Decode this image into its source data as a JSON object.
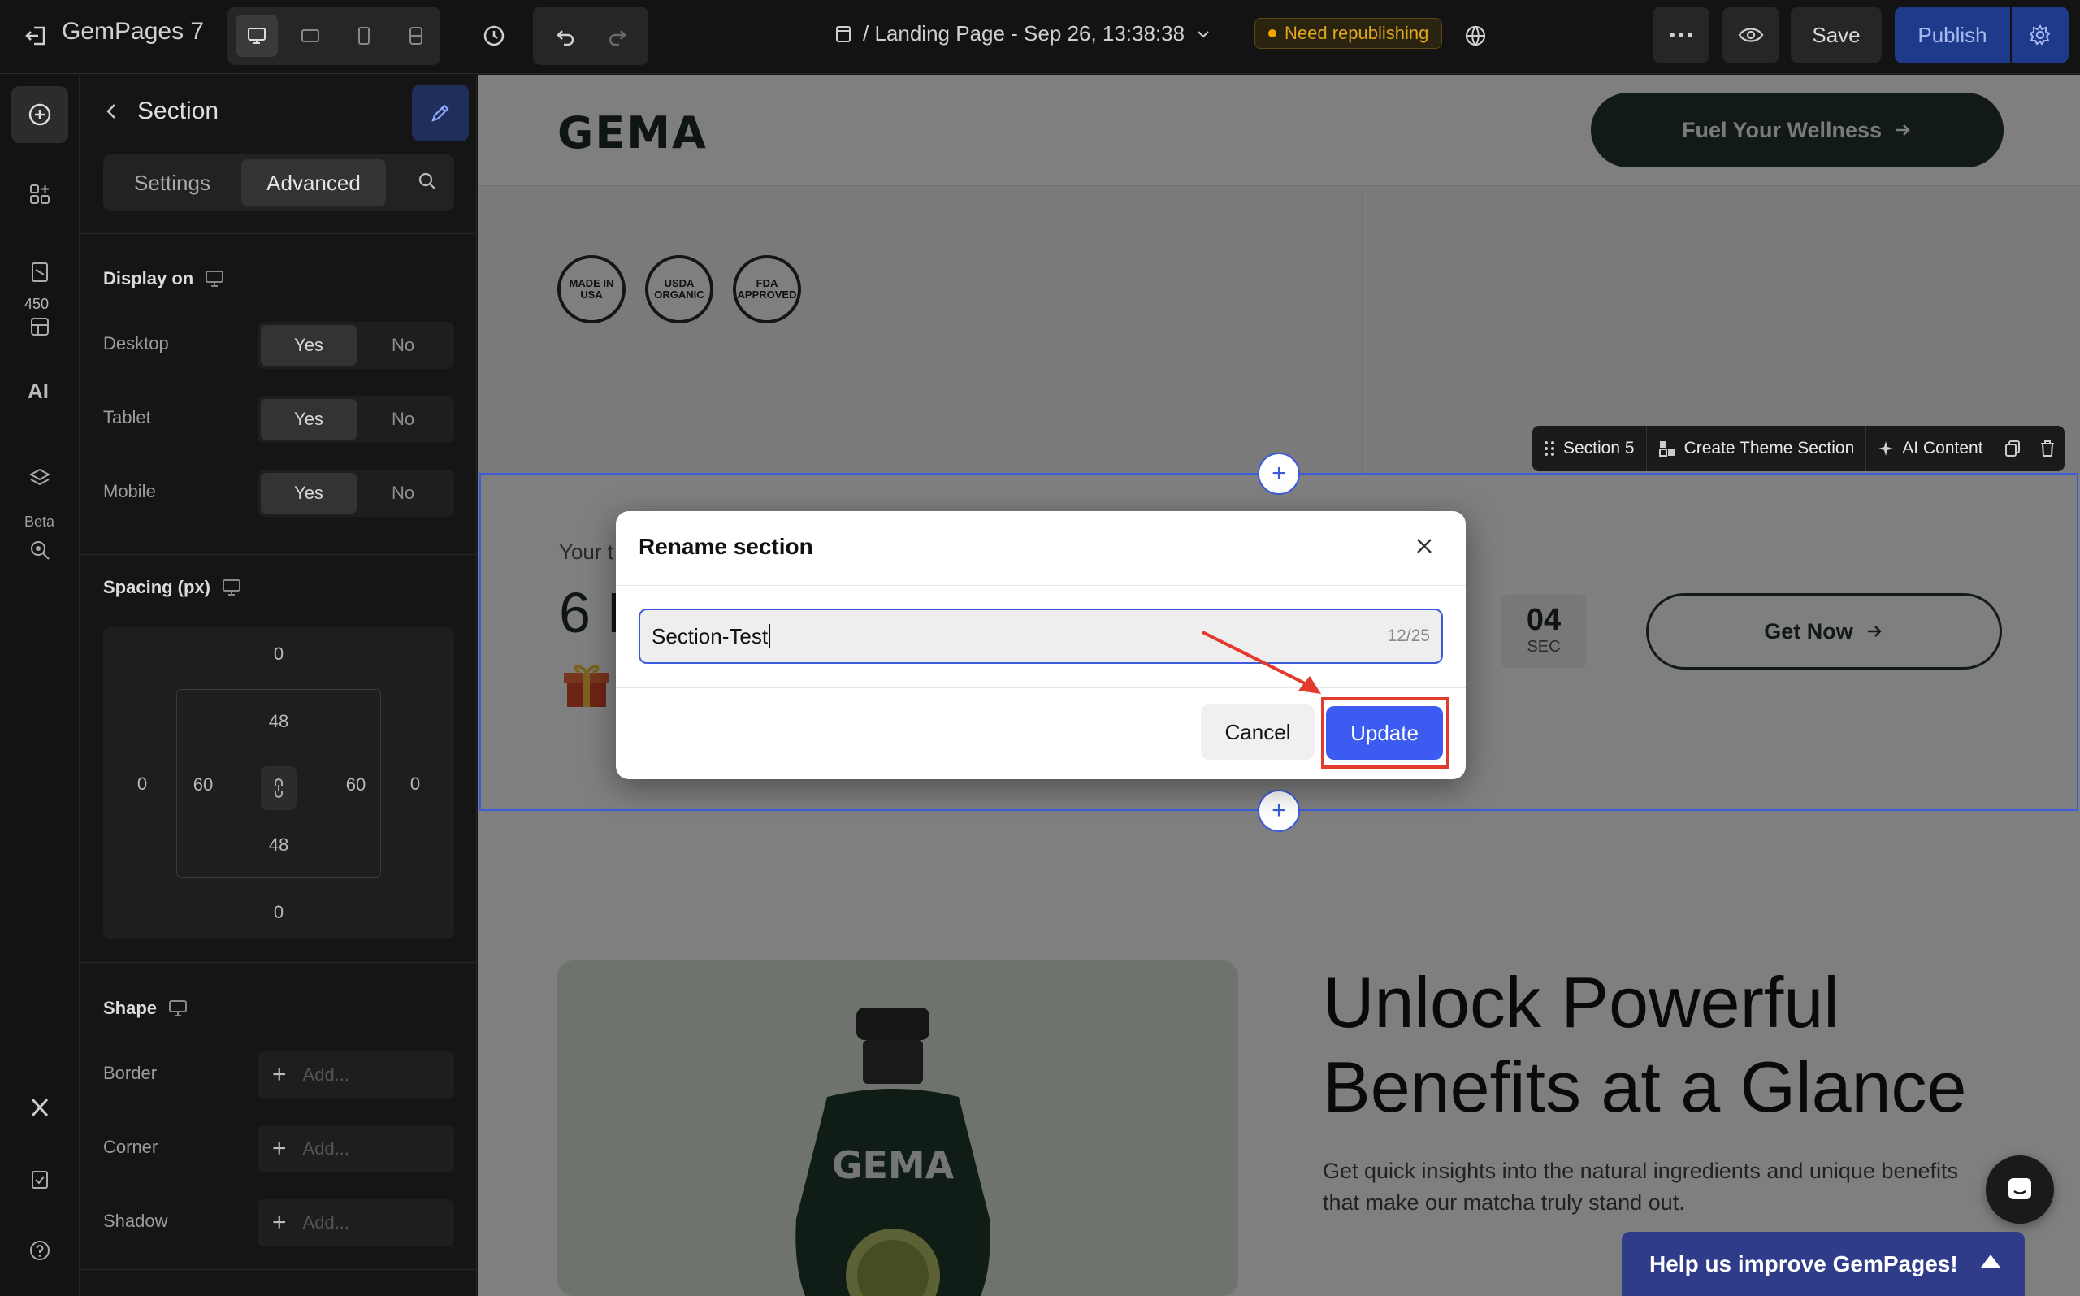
{
  "app": {
    "name": "GemPages 7",
    "page_title": "/ Landing Page - Sep 26, 13:38:38",
    "status_badge": "Need republishing",
    "save_label": "Save",
    "publish_label": "Publish"
  },
  "rail": {
    "count_badge": "450",
    "ai_label": "AI",
    "beta_label": "Beta"
  },
  "panel": {
    "title": "Section",
    "tabs": [
      "Settings",
      "Advanced"
    ],
    "display_on": {
      "label": "Display on",
      "rows": [
        {
          "label": "Desktop",
          "yes": "Yes",
          "no": "No"
        },
        {
          "label": "Tablet",
          "yes": "Yes",
          "no": "No"
        },
        {
          "label": "Mobile",
          "yes": "Yes",
          "no": "No"
        }
      ]
    },
    "spacing": {
      "label": "Spacing (px)",
      "margin_top": "0",
      "margin_bottom": "0",
      "margin_left": "0",
      "margin_right": "0",
      "padding_top": "48",
      "padding_bottom": "48",
      "padding_left": "60",
      "padding_right": "60"
    },
    "shape": {
      "label": "Shape",
      "rows": [
        {
          "label": "Border",
          "placeholder": "Add..."
        },
        {
          "label": "Corner",
          "placeholder": "Add..."
        },
        {
          "label": "Shadow",
          "placeholder": "Add..."
        }
      ]
    }
  },
  "canvas": {
    "logo": "GEMA",
    "fuel_button": "Fuel Your Wellness",
    "seals": [
      "MADE IN USA",
      "USDA ORGANIC",
      "FDA APPROVED"
    ],
    "section_toolbar": {
      "section_name": "Section 5",
      "create_theme": "Create Theme Section",
      "ai_content": "AI Content"
    },
    "countdown": {
      "intro": "Your t",
      "big_text": "6 I",
      "sec_value": "04",
      "sec_unit": "SEC",
      "get_now": "Get Now"
    },
    "product_logo": "GEMA",
    "unlock_title": "Unlock Powerful Benefits at a Glance",
    "unlock_desc": "Get quick insights into the natural ingredients and unique benefits that make our matcha truly stand out.",
    "help_bar": "Help us improve GemPages!"
  },
  "modal": {
    "title": "Rename section",
    "input_value": "Section-Test",
    "char_count": "12/25",
    "cancel_label": "Cancel",
    "update_label": "Update"
  }
}
